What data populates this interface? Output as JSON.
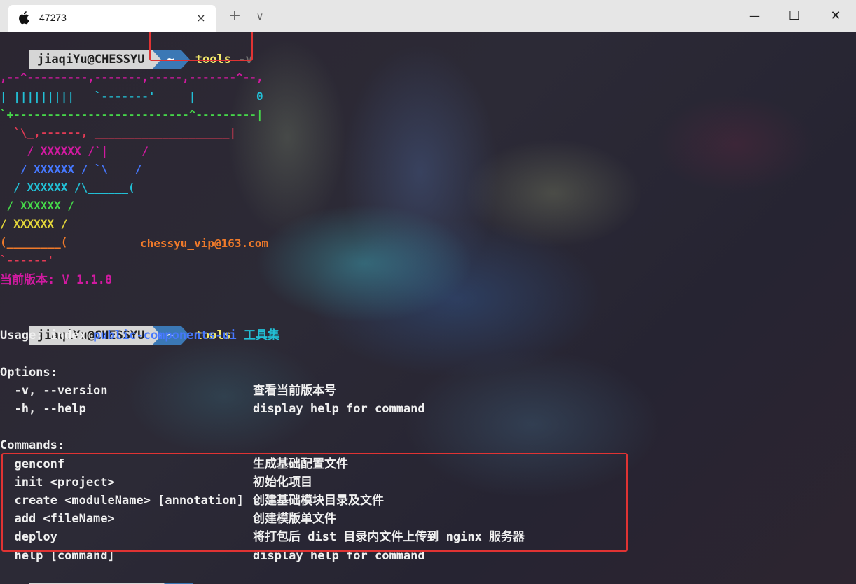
{
  "window": {
    "tab_title": "47273",
    "tab_icon": "apple-icon",
    "close_tab": "×",
    "new_tab": "+",
    "dropdown": "∨",
    "minimize": "—",
    "maximize": "☐",
    "close": "✕"
  },
  "prompt": {
    "user": "jiaqiYu@CHESSYU",
    "dir": "~",
    "error_mark": "×"
  },
  "commands": {
    "first": "tools",
    "first_arg": "-v",
    "second": "tools"
  },
  "banner": {
    "lines": [
      ",--^---------,-------,-----,-------^--,",
      "| |||||||||   `-------'     |         0",
      "`+--------------------------^---------|",
      "  `\\_,------, ____________________|",
      "    / XXXXXX /`|     /",
      "   / XXXXXX / `\\    /",
      "  / XXXXXX /\\______(",
      " / XXXXXX /",
      "/ XXXXXX /",
      "(________(",
      "`------'"
    ],
    "email": "chessyu_vip@163.com",
    "version_line": "当前版本: V 1.1.8"
  },
  "help": {
    "usage_prefix": "Usage: index ",
    "usage_pkg": "public-components-ui",
    "usage_desc": " 工具集",
    "options_header": "Options:",
    "options": [
      {
        "flag": "  -v, --version",
        "desc": "查看当前版本号"
      },
      {
        "flag": "  -h, --help",
        "desc": "display help for command"
      }
    ],
    "commands_header": "Commands:",
    "commands": [
      {
        "cmd": "  genconf",
        "desc": "生成基础配置文件"
      },
      {
        "cmd": "  init <project>",
        "desc": "初始化项目"
      },
      {
        "cmd": "  create <moduleName> [annotation]",
        "desc": "创建基础模块目录及文件"
      },
      {
        "cmd": "  add <fileName>",
        "desc": "创建模版单文件"
      },
      {
        "cmd": "  deploy",
        "desc": "将打包后 dist 目录内文件上传到 nginx 服务器"
      },
      {
        "cmd": "  help [command]",
        "desc": "display help for command"
      }
    ]
  },
  "colors": {
    "highlight_box": "#e03333",
    "prompt_bg": "#d6d6d6",
    "dir_bg": "#3b78b5",
    "command": "#f2e96a"
  }
}
